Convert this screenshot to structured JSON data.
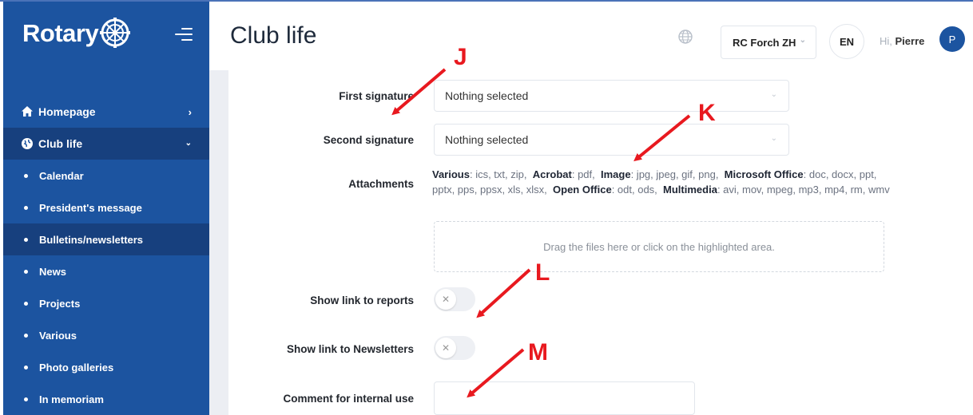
{
  "sidebar": {
    "brand_text": "Rotary",
    "nav": {
      "homepage": "Homepage",
      "club_life": "Club life"
    },
    "sub_items": [
      "Calendar",
      "President's message",
      "Bulletins/newsletters",
      "News",
      "Projects",
      "Various",
      "Photo galleries",
      "In memoriam"
    ],
    "active_sub_item": "Bulletins/newsletters"
  },
  "header": {
    "title": "Club life",
    "club_selector": "RC Forch ZH",
    "language": "EN",
    "greeting": "Hi,",
    "user_name": "Pierre",
    "avatar_initial": "P"
  },
  "form": {
    "first_signature_label": "First signature",
    "first_signature_value": "Nothing selected",
    "second_signature_label": "Second signature",
    "second_signature_value": "Nothing selected",
    "attachments_label": "Attachments",
    "attach_various_title": "Various",
    "attach_various_types": ": ics, txt, zip,",
    "attach_acrobat_title": "Acrobat",
    "attach_acrobat_types": ": pdf,",
    "attach_image_title": "Image",
    "attach_image_types": ": jpg, jpeg, gif, png,",
    "attach_msoffice_title": "Microsoft Office",
    "attach_msoffice_types": ": doc, docx, ppt, pptx, pps, ppsx, xls, xlsx,",
    "attach_openoffice_title": "Open Office",
    "attach_openoffice_types": ": odt, ods,",
    "attach_multimedia_title": "Multimedia",
    "attach_multimedia_types": ": avi, mov, mpeg, mp3, mp4, rm, wmv",
    "dropzone_text": "Drag the files here or click on the highlighted area.",
    "show_reports_label": "Show link to reports",
    "show_reports_on": false,
    "show_newsletters_label": "Show link to Newsletters",
    "show_newsletters_on": false,
    "comment_label": "Comment for internal use",
    "comment_value": ""
  },
  "annotations": {
    "j": "J",
    "k": "K",
    "l": "L",
    "m": "M",
    "color": "#e8191f"
  },
  "colors": {
    "sidebar_bg": "#1c54a0",
    "sidebar_active": "#17407e",
    "accent": "#1c54a0"
  },
  "icons": {
    "home": "home-icon",
    "globe": "globe-icon",
    "caret": "chevron-down-icon",
    "toggle_off": "close-icon"
  }
}
